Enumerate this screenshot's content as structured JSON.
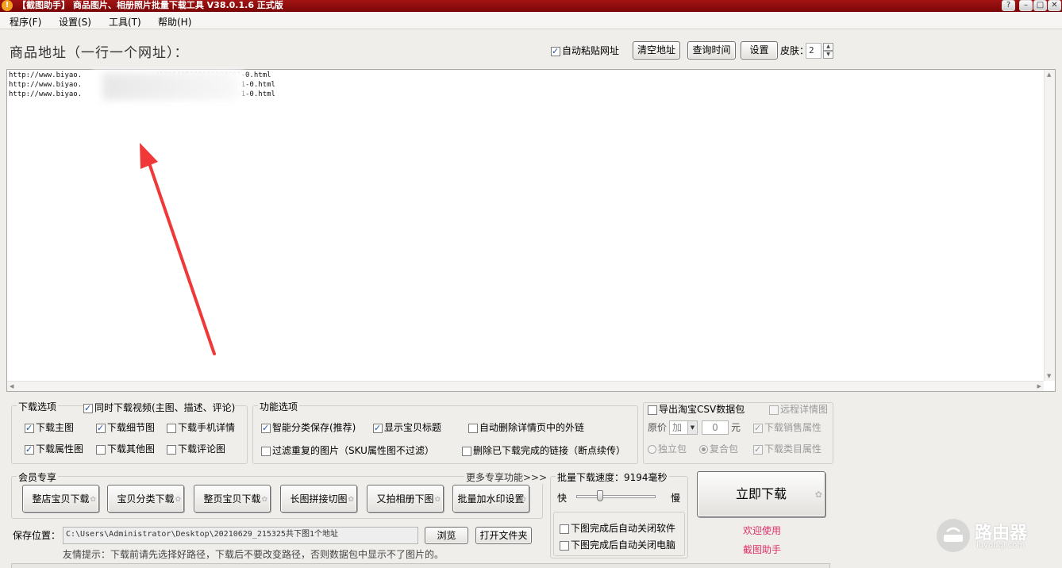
{
  "window": {
    "title": "【截图助手】 商品图片、相册照片批量下载工具 V38.0.1.6 正式版",
    "buttons": [
      "?",
      "–",
      "□",
      "✕"
    ]
  },
  "menu": {
    "program": "程序(F)",
    "settings": "设置(S)",
    "tools": "工具(T)",
    "help": "帮助(H)"
  },
  "header": {
    "heading": "商品地址（一行一个网址）：",
    "auto_paste_label": "自动粘贴网址",
    "auto_paste_checked": true,
    "clear_button": "清空地址",
    "query_time_button": "查询时间",
    "settings_button": "设置",
    "skin_label": "皮肤：",
    "skin_value": "2"
  },
  "urls": [
    "http://www.biyao.                 /1301405109010000001-0.html",
    "http://www.biyao.                                   001-0.html",
    "http://www.biyao.                                   001-0.html"
  ],
  "download_options": {
    "title": "下载选项",
    "items": [
      {
        "label": "同时下载视频(主图、描述、评论)",
        "checked": true
      },
      {
        "label": "下载主图",
        "checked": true
      },
      {
        "label": "下载细节图",
        "checked": true
      },
      {
        "label": "下载手机详情",
        "checked": false
      },
      {
        "label": "下载属性图",
        "checked": true
      },
      {
        "label": "下载其他图",
        "checked": false
      },
      {
        "label": "下载评论图",
        "checked": false
      }
    ]
  },
  "function_options": {
    "title": "功能选项",
    "items": [
      {
        "label": "智能分类保存(推荐)",
        "checked": true
      },
      {
        "label": "显示宝贝标题",
        "checked": true
      },
      {
        "label": "自动删除详情页中的外链",
        "checked": false
      },
      {
        "label": "过滤重复的图片（SKU属性图不过滤）",
        "checked": false
      },
      {
        "label": "删除已下载完成的链接（断点续传）",
        "checked": false
      }
    ]
  },
  "export_options": {
    "export_csv_label": "导出淘宝CSV数据包",
    "remote_detail_label": "远程详情图",
    "price_label": "原价",
    "price_op": "加",
    "price_value": "0",
    "price_unit": "元",
    "download_sales_attr_label": "下载销售属性",
    "standalone_label": "独立包",
    "composite_label": "复合包",
    "download_category_attr_label": "下载类目属性"
  },
  "member": {
    "title": "会员专享",
    "more_link": "更多专享功能>>>",
    "buttons": [
      "整店宝贝下载",
      "宝贝分类下载",
      "整页宝贝下载",
      "长图拼接切图",
      "又拍相册下图",
      "批量加水印设置"
    ]
  },
  "speed": {
    "title": "批量下载速度：9194毫秒",
    "fast": "快",
    "slow": "慢",
    "level": 0.3,
    "close_app_label": "下图完成后自动关闭软件",
    "shutdown_label": "下图完成后自动关闭电脑"
  },
  "download_button": "立即下载",
  "welcome": "欢迎使用",
  "brand": "截图助手",
  "save": {
    "label": "保存位置：",
    "path": "C:\\Users\\Administrator\\Desktop\\20210629_215325共下图1个地址",
    "browse": "浏览",
    "open_folder": "打开文件夹",
    "tip": "友情提示：下载前请先选择好路径，下载后不要改变路径，否则数据包中显示不了图片的。"
  },
  "watermark": {
    "name": "路由器",
    "domain": "luyouqi.com"
  },
  "colors": {
    "titlebar": "#8e0c0c",
    "brand_text": "#e0306a",
    "arrow": "#f03838"
  }
}
